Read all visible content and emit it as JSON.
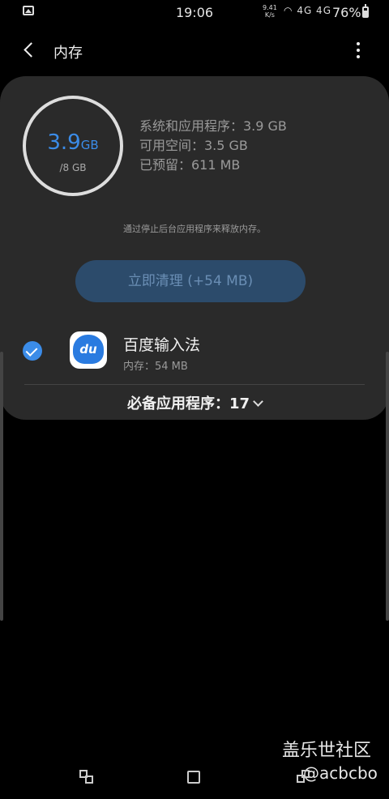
{
  "status_bar": {
    "time": "19:06",
    "speed_value": "9.41",
    "speed_unit": "K/s",
    "network_icons": "4G 4G",
    "battery_percent": "76%"
  },
  "app_bar": {
    "title": "内存"
  },
  "memory": {
    "used_number": "3.9",
    "used_unit": "GB",
    "total": "/8 GB",
    "system_apps": "系统和应用程序：3.9 GB",
    "available": "可用空间：3.5 GB",
    "reserved": "已预留：611 MB",
    "hint": "通过停止后台应用程序来释放内存。",
    "clean_button": "立即清理 (+54 MB)"
  },
  "apps": [
    {
      "name": "百度输入法",
      "memory": "内存：54 MB",
      "icon_text": "du",
      "checked": true
    }
  ],
  "essential_apps": {
    "label": "必备应用程序：17"
  },
  "watermark": {
    "site": "盖乐世社区",
    "handle": "@acbcbo"
  },
  "colors": {
    "accent": "#3b8ce8",
    "card": "#2a2a2a",
    "button": "#2c4b6b"
  }
}
